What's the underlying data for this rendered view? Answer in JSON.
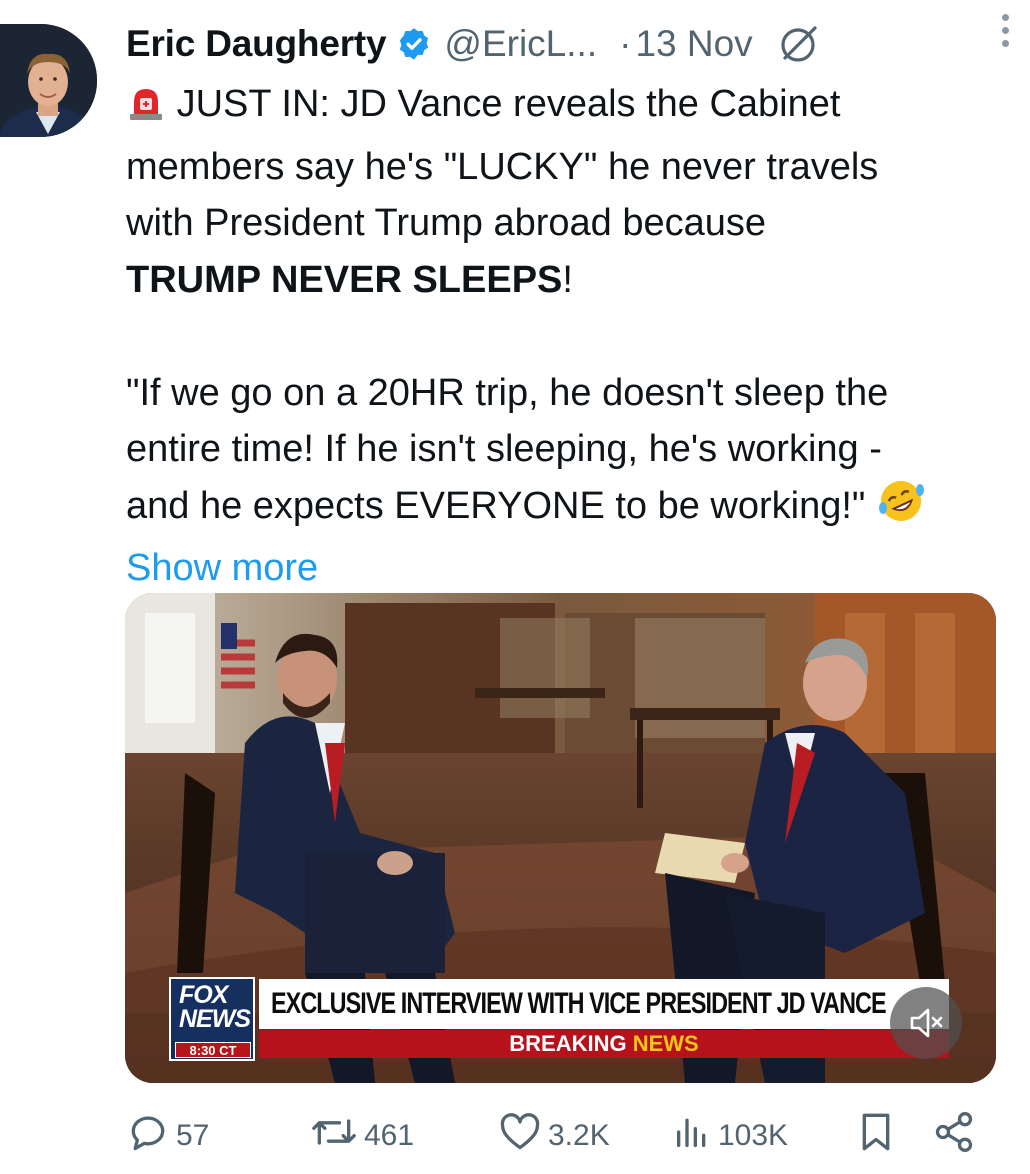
{
  "tweet": {
    "author_name": "Eric Daugherty",
    "handle": "@EricL...",
    "separator": "·",
    "date": "13 Nov",
    "alert_emoji": "rotating-light-icon",
    "text_line1": "JUST IN: JD Vance reveals the Cabinet",
    "text_line2": "members say he's \"LUCKY\" he never travels",
    "text_line3": "with President Trump abroad because",
    "text_bold": "TRUMP NEVER SLEEPS",
    "text_bold_suffix": "!",
    "quote_line1": "\"If we go on a 20HR trip, he doesn't sleep the",
    "quote_line2": "entire time! If he isn't sleeping, he's working -",
    "quote_line3": "and he expects EVERYONE to be working!\"",
    "quote_emoji": "rofl-emoji",
    "show_more": "Show more"
  },
  "media": {
    "network_logo_top": "FOX",
    "network_logo_bottom": "NEWS",
    "time": "8:30 CT",
    "headline": "EXCLUSIVE INTERVIEW WITH VICE PRESIDENT JD VANCE",
    "breaking_white": "BREAKING",
    "breaking_yellow": "NEWS",
    "muted": true
  },
  "actions": {
    "replies": "57",
    "reposts": "461",
    "likes": "3.2K",
    "views": "103K"
  },
  "colors": {
    "accent": "#1d9bf0",
    "muted_text": "#536471",
    "text": "#0f1419"
  }
}
